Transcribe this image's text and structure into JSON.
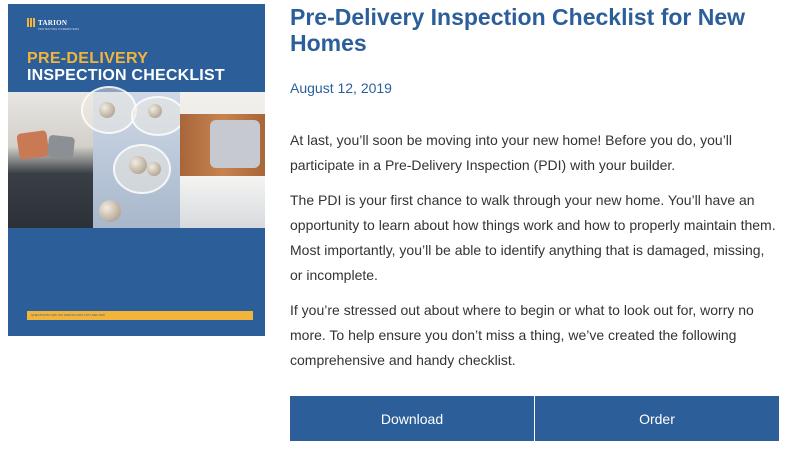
{
  "cover": {
    "logo_text": "TARION",
    "logo_subtext": "PROTECTING HOMEBUYERS",
    "title_line1": "PRE-DELIVERY",
    "title_line2": "INSPECTION CHECKLIST",
    "footer_text": "QUESTIONS?   ASK US!   TARION.COM   1-877-982-7466"
  },
  "article": {
    "title": "Pre-Delivery Inspection Checklist for New Homes",
    "date": "August 12, 2019",
    "paragraphs": [
      "At last, you’ll soon be moving into your new home! Before you do, you’ll participate in a Pre-Delivery Inspection (PDI) with your builder.",
      "The PDI is your first chance to walk through your new home.  You’ll have an opportunity to learn about how things work and how to properly maintain them.  Most importantly, you’ll be able to identify anything that is damaged, missing, or incomplete.",
      "If you’re stressed out about where to begin or what to look out for, worry no more.  To help ensure you don’t miss a thing, we’ve created the following comprehensive and handy checklist."
    ]
  },
  "actions": {
    "download_label": "Download",
    "order_label": "Order"
  },
  "colors": {
    "brand_blue": "#2c5f9a",
    "accent_gold": "#f3b43c"
  }
}
